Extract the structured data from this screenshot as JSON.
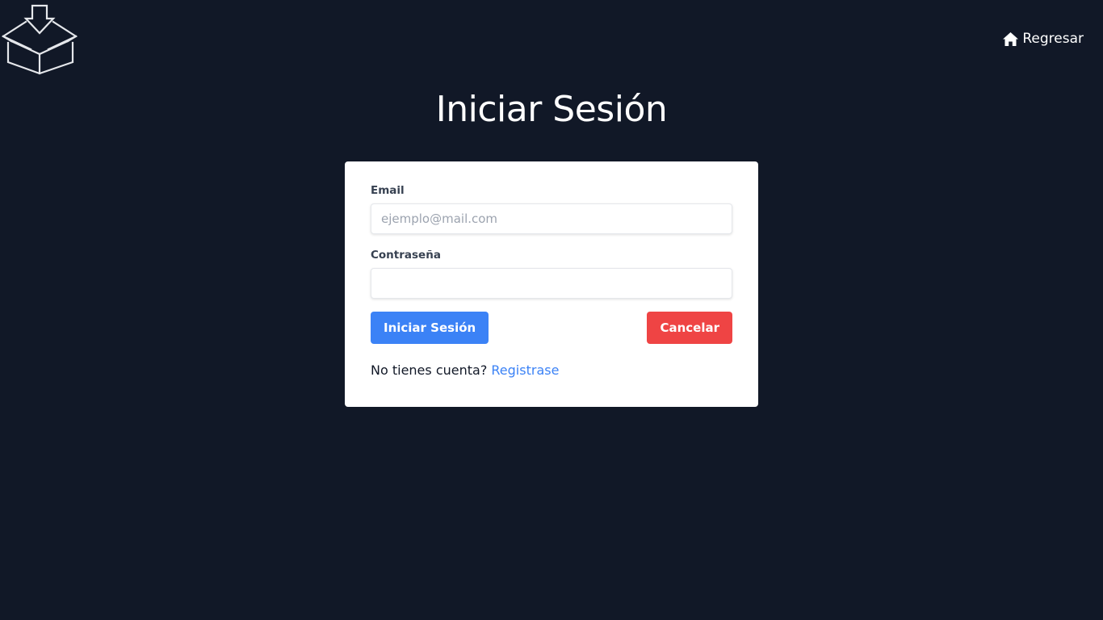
{
  "header": {
    "logo_icon": "box-download-icon",
    "home_icon": "home-icon",
    "home_label": "Regresar"
  },
  "main": {
    "title": "Iniciar Sesión"
  },
  "form": {
    "email_label": "Email",
    "email_placeholder": "ejemplo@mail.com",
    "email_value": "",
    "password_label": "Contraseña",
    "password_value": "",
    "submit_label": "Iniciar Sesión",
    "cancel_label": "Cancelar",
    "no_account_text": "No tienes cuenta?",
    "register_link": "Registrase"
  },
  "colors": {
    "background": "#111827",
    "primary": "#3b82f6",
    "danger": "#ef4444",
    "card": "#ffffff"
  }
}
